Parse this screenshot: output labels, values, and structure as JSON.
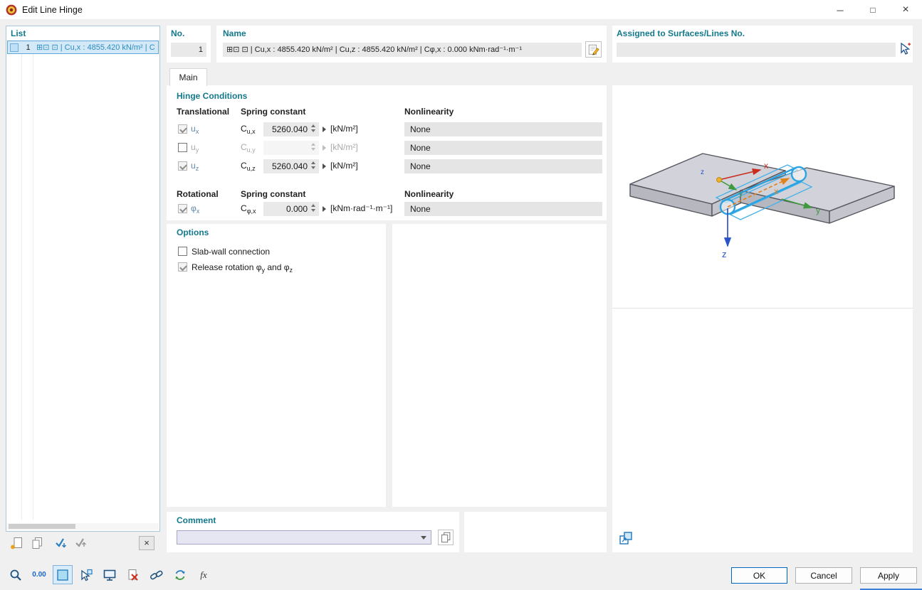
{
  "window": {
    "title": "Edit Line Hinge",
    "controls": {
      "minimize": "─",
      "maximize": "□",
      "close": "×"
    }
  },
  "list_panel": {
    "header": "List",
    "item": {
      "no": "1",
      "text": "⊞⊡ ⊡ | Cu,x : 4855.420 kN/m² | C"
    }
  },
  "identification": {
    "no_label": "No.",
    "no_value": "1",
    "name_label": "Name",
    "name_value": "⊞⊡ ⊡ | Cu,x : 4855.420 kN/m² | Cu,z : 4855.420 kN/m² | Cφ,x : 0.000 kNm·rad⁻¹·m⁻¹",
    "assigned_label": "Assigned to Surfaces/Lines No.",
    "assigned_value": ""
  },
  "tabs": {
    "main": "Main"
  },
  "hinge_conditions": {
    "title": "Hinge Conditions",
    "headers": {
      "translational": "Translational",
      "rotational": "Rotational",
      "spring_constant": "Spring constant",
      "nonlinearity": "Nonlinearity"
    },
    "rows": [
      {
        "dof": "u",
        "dof_sub": "x",
        "coef": "C",
        "coef_sub": "u,x",
        "value": "5260.040",
        "unit": "[kN/m²]",
        "nonlinearity": "None",
        "checked": true,
        "enabled": false
      },
      {
        "dof": "u",
        "dof_sub": "y",
        "coef": "C",
        "coef_sub": "u,y",
        "value": "",
        "unit": "[kN/m²]",
        "nonlinearity": "None",
        "checked": false,
        "enabled": true
      },
      {
        "dof": "u",
        "dof_sub": "z",
        "coef": "C",
        "coef_sub": "u,z",
        "value": "5260.040",
        "unit": "[kN/m²]",
        "nonlinearity": "None",
        "checked": true,
        "enabled": false
      },
      {
        "dof": "φ",
        "dof_sub": "x",
        "coef": "C",
        "coef_sub": "φ,x",
        "value": "0.000",
        "unit": "[kNm·rad⁻¹·m⁻¹]",
        "nonlinearity": "None",
        "checked": true,
        "enabled": false
      }
    ]
  },
  "options": {
    "title": "Options",
    "slab_wall": {
      "label": "Slab-wall connection",
      "checked": false
    },
    "release_rotation": {
      "label_prefix": "Release rotation φ",
      "sub1": "y",
      "label_mid": " and φ",
      "sub2": "z",
      "checked": true
    }
  },
  "comment": {
    "title": "Comment",
    "value": ""
  },
  "viewport": {
    "axes": {
      "x": "x",
      "y": "y",
      "z": "z"
    }
  },
  "footer": {
    "decimal_button": "0.00",
    "fx_button": "fx",
    "ok": "OK",
    "cancel": "Cancel",
    "apply": "Apply"
  }
}
